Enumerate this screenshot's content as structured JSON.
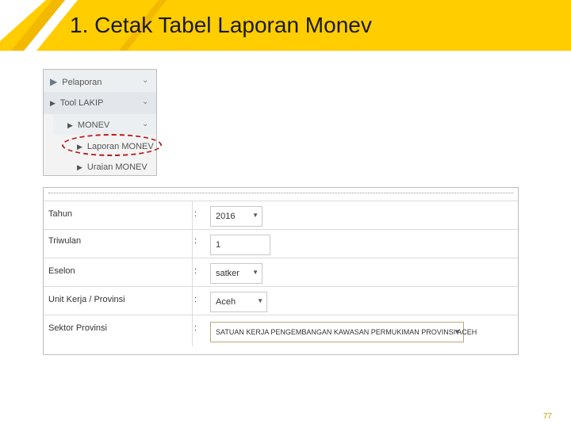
{
  "slide": {
    "title": "1.  Cetak Tabel Laporan Monev",
    "page_number": "77",
    "accent_color": "#ffcd00"
  },
  "menu": {
    "items": [
      {
        "label": "Pelaporan",
        "icon": "play-arrow-icon",
        "expanded_icon": "chevron-down-icon"
      },
      {
        "label": "Tool LAKIP",
        "icon": "play-arrow-icon",
        "expanded_icon": "chevron-down-icon"
      },
      {
        "label": "MONEV",
        "icon": "play-arrow-icon",
        "expanded_icon": "chevron-down-icon"
      },
      {
        "label": "Laporan MONEV",
        "icon": "play-arrow-icon",
        "highlighted": true
      },
      {
        "label": "Uraian MONEV",
        "icon": "play-arrow-icon"
      }
    ]
  },
  "form": {
    "fields": [
      {
        "label": "Tahun",
        "colon": ":",
        "value": "2016"
      },
      {
        "label": "Triwulan",
        "colon": ":",
        "value": "1"
      },
      {
        "label": "Eselon",
        "colon": ":",
        "value": "satker"
      },
      {
        "label": "Unit Kerja / Provinsi",
        "colon": ":",
        "value": "Aceh"
      },
      {
        "label": "Sektor Provinsi",
        "colon": ":",
        "value": "SATUAN KERJA PENGEMBANGAN KAWASAN PERMUKIMAN PROVINSI ACEH"
      }
    ]
  }
}
